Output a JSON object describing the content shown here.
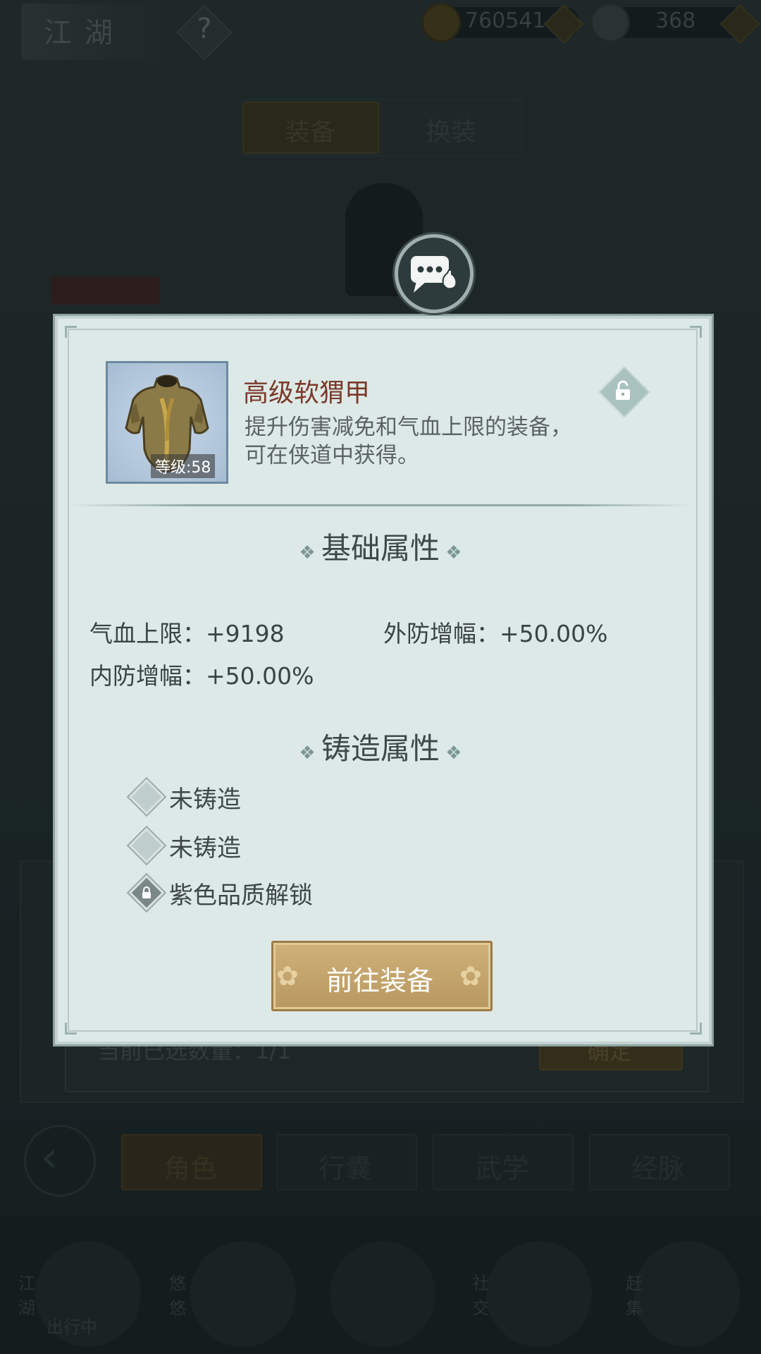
{
  "header": {
    "title": "江湖",
    "help_glyph": "?",
    "currency": [
      {
        "icon": "coin-icon",
        "value": "760541"
      },
      {
        "icon": "silver-ingot-icon",
        "value": "368"
      }
    ]
  },
  "tabs": [
    "装备",
    "换装"
  ],
  "background_panel": {
    "selected_count_text": "当前已选数量：1/1",
    "confirm_label": "确定"
  },
  "bottom_nav": {
    "items": [
      "角色",
      "行囊",
      "武学",
      "经脉"
    ],
    "active": "角色"
  },
  "dock": {
    "items": [
      "江湖",
      "悠悠",
      "社交",
      "赶集"
    ],
    "status_text": "出行中"
  },
  "popup": {
    "item": {
      "name": "高级软猬甲",
      "level_text": "等级:58",
      "desc_line1": "提升伤害减免和气血上限的装备，",
      "desc_line2": "可在侠道中获得。"
    },
    "base_section_title": "基础属性",
    "base_attrs": [
      "气血上限：+9198",
      "外防增幅：+50.00%",
      "内防增幅：+50.00%"
    ],
    "forge_section_title": "铸造属性",
    "forge_slots": [
      {
        "label": "未铸造",
        "locked": false
      },
      {
        "label": "未铸造",
        "locked": false
      },
      {
        "label": "紫色品质解锁",
        "locked": true
      }
    ],
    "goto_button_label": "前往装备"
  },
  "colors": {
    "item_name": "#7b3a2a",
    "popup_bg": "#dde9e7",
    "button_gold": "#c4a46c"
  }
}
